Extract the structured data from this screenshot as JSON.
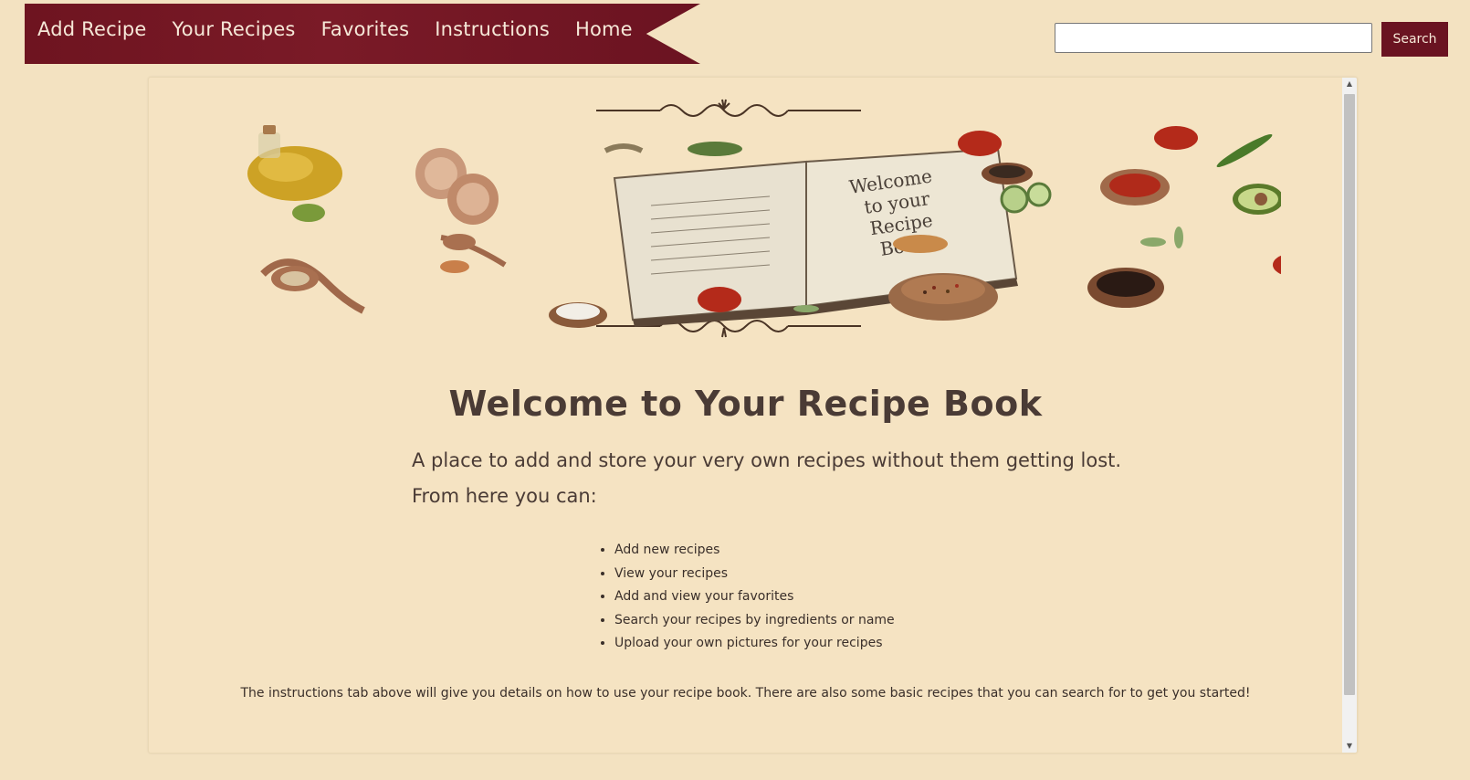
{
  "nav": {
    "items": [
      {
        "label": "Add Recipe"
      },
      {
        "label": "Your Recipes"
      },
      {
        "label": "Favorites"
      },
      {
        "label": "Instructions"
      },
      {
        "label": "Home"
      }
    ]
  },
  "search": {
    "value": "",
    "placeholder": "",
    "button_label": "Search"
  },
  "hero": {
    "book_text": [
      "Welcome",
      "to your",
      "Recipe",
      "Book"
    ]
  },
  "main": {
    "title": "Welcome to Your Recipe Book",
    "intro_line1": "A place to add and store your very own recipes without them getting lost.",
    "intro_line2": "From here you can:",
    "features": [
      "Add new recipes",
      "View your recipes",
      "Add and view your favorites",
      "Search your recipes by ingredients or name",
      "Upload your own pictures for your recipes"
    ],
    "footer_note": "The instructions tab above will give you details on how to use your recipe book. There are also some basic recipes that you can search for to get you started!"
  },
  "colors": {
    "page_background": "#f3e2c1",
    "nav_banner": "#6e1420",
    "nav_text": "#f6e8d8",
    "search_button": "#6a1321",
    "text": "#4a3b35"
  },
  "icons": [
    "scroll-up-arrow-icon",
    "scroll-down-arrow-icon"
  ]
}
